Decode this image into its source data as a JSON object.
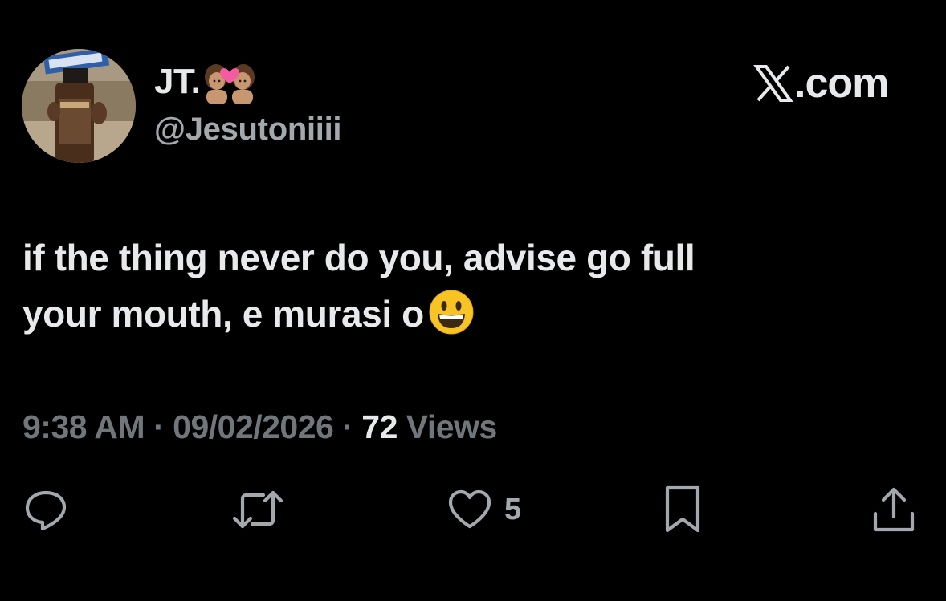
{
  "author": {
    "display_name": "JT.",
    "name_emoji": "couple-with-heart-emoji",
    "handle": "@Jesutoniiii",
    "avatar": "avatar-photo-bottle"
  },
  "brand": {
    "x_logo": "x-logo-icon",
    "text": ".com"
  },
  "tweet": {
    "text": "if the thing never do you, advise go full\nyour mouth, e murasi o",
    "emoji": "grinning-face-emoji"
  },
  "meta": {
    "time": "9:38 AM",
    "separator": " · ",
    "date": "09/02/2026",
    "views_count": "72",
    "views_label": " Views"
  },
  "actions": {
    "reply_icon": "reply-icon",
    "retweet_icon": "retweet-icon",
    "like_icon": "heart-icon",
    "like_count": "5",
    "bookmark_icon": "bookmark-icon",
    "share_icon": "share-icon"
  },
  "colors": {
    "background": "#000000",
    "primary_text": "#e7e9ea",
    "secondary_text": "#71767b",
    "icon": "#a3a8ad"
  }
}
